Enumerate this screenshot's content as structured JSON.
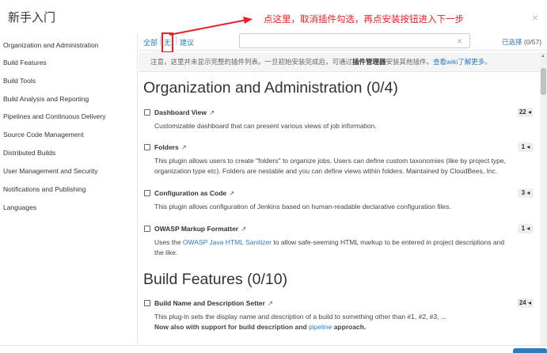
{
  "header": {
    "title": "新手入门",
    "annotation": "点这里，取消插件勾选，再点安装按钮进入下一步",
    "close_icon": "close-icon"
  },
  "sidebar": {
    "items": [
      "Organization and Administration",
      "Build Features",
      "Build Tools",
      "Build Analysis and Reporting",
      "Pipelines and Continuous Delivery",
      "Source Code Management",
      "Distributed Builds",
      "User Management and Security",
      "Notifications and Publishing",
      "Languages"
    ]
  },
  "toolbar": {
    "all": "全部",
    "none": "无",
    "suggested": "建议",
    "search_value": "",
    "selected_label": "已选择",
    "selected_count": "(0/57)"
  },
  "notice": {
    "part1": "注意，这里并未显示完整的插件列表。一旦初始安装完成后，可通过",
    "bold": "插件管理器",
    "part2": "安装其他插件。",
    "link": "查看wiki了解更多。"
  },
  "sections": [
    {
      "heading": "Organization and Administration (0/4)"
    },
    {
      "heading": "Build Features (0/10)"
    }
  ],
  "plugins": [
    {
      "name": "Dashboard View",
      "ext": "↗",
      "deps": "22 ◂",
      "desc1": "Customizable dashboard that can present various views of job information."
    },
    {
      "name": "Folders",
      "ext": "↗",
      "deps": "1 ◂",
      "desc1": "This plugin allows users to create \"folders\" to organize jobs. Users can define custom taxonomies (like by project type,",
      "desc2": "organization type etc). Folders are nestable and you can define views within folders. Maintained by CloudBees, Inc."
    },
    {
      "name": "Configuration as Code",
      "ext": "↗",
      "deps": "3 ◂",
      "desc1": "This plugin allows configuration of Jenkins based on human-readable declarative configuration files."
    },
    {
      "name": "OWASP Markup Formatter",
      "ext": "↗",
      "deps": "1 ◂",
      "desc_pre": "Uses the ",
      "desc_link": "OWASP Java HTML Sanitizer",
      "desc_post": " to allow safe-seeming HTML markup to be entered in project descriptions and",
      "desc2": "the like."
    },
    {
      "name": "Build Name and Description Setter",
      "ext": "↗",
      "deps": "24 ◂",
      "desc1": "This plug-in sets the display name and description of a build to something other than #1, #2, #3, ...",
      "desc2_pre": "Now also with support for build description and ",
      "desc2_link": "pipeline",
      "desc2_post": " approach."
    }
  ],
  "colors": {
    "accent": "#2b7bbd",
    "annotation_red": "#e8202a"
  }
}
